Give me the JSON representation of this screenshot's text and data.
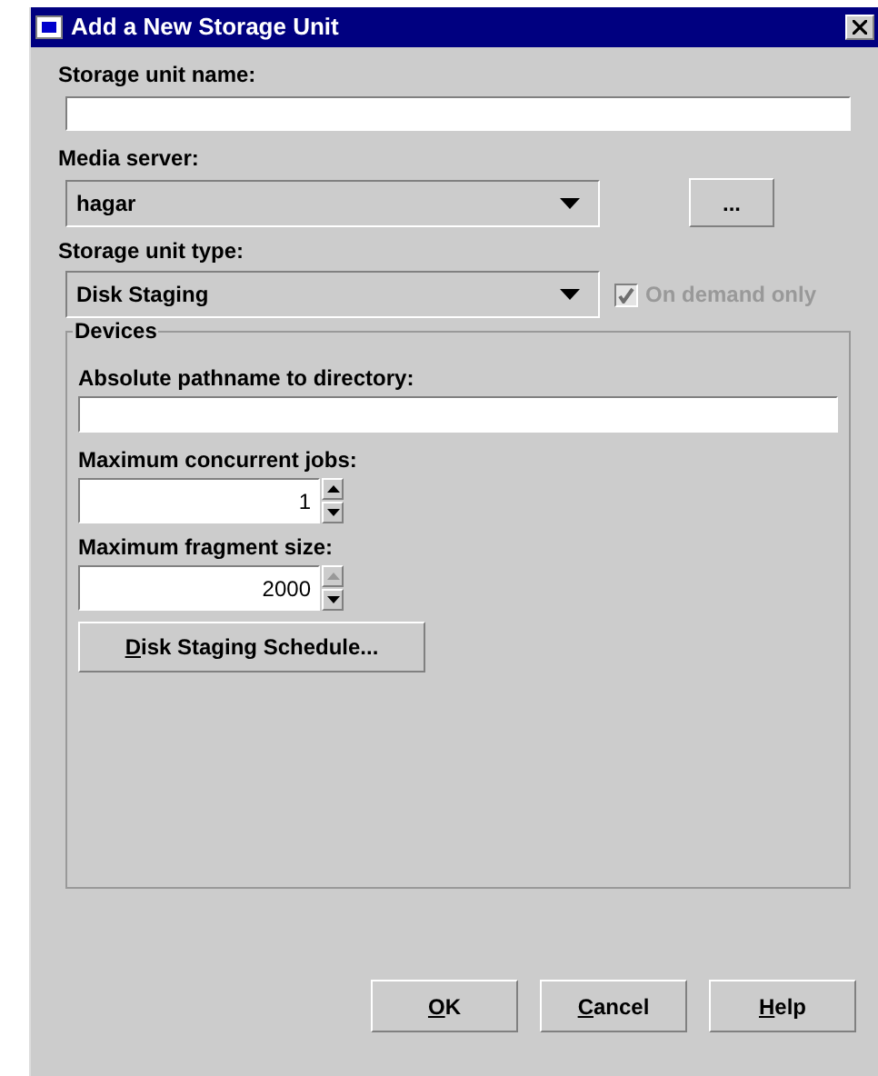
{
  "window": {
    "title": "Add a New Storage Unit"
  },
  "storage_unit_name": {
    "label": "Storage unit name:"
  },
  "media_server": {
    "label": "Media server:",
    "value": "hagar",
    "browse_button": "..."
  },
  "storage_unit_type": {
    "label": "Storage unit type:",
    "value": "Disk Staging",
    "on_demand": {
      "label": "On demand only",
      "checked": true,
      "disabled": true
    }
  },
  "devices": {
    "title": "Devices",
    "pathname": {
      "label": "Absolute pathname to directory:"
    },
    "concurrent_jobs": {
      "label": "Maximum concurrent jobs:",
      "value": "1",
      "up_disabled": false,
      "down_disabled": false
    },
    "fragment_size": {
      "label": "Maximum fragment size:",
      "value": "2000",
      "up_disabled": true,
      "down_disabled": false
    },
    "schedule_button": {
      "mnemonic": "D",
      "rest": "isk Staging Schedule..."
    }
  },
  "buttons": [
    {
      "mnemonic": "O",
      "rest": "K"
    },
    {
      "mnemonic": "C",
      "rest": "ancel"
    },
    {
      "mnemonic": "H",
      "rest": "elp"
    }
  ]
}
